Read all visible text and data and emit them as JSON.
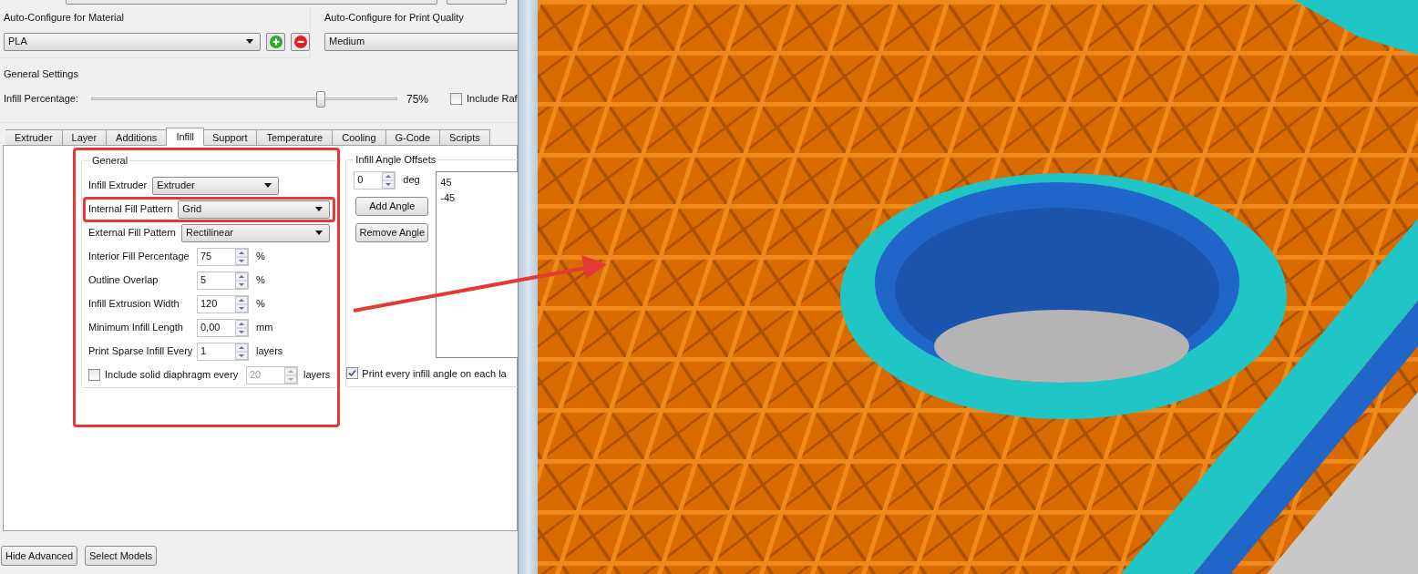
{
  "material": {
    "label": "Auto-Configure for Material",
    "value": "PLA"
  },
  "quality": {
    "label": "Auto-Configure for Print Quality",
    "value": "Medium"
  },
  "general_settings": {
    "title": "General Settings",
    "infill_label": "Infill Percentage:",
    "level": 0.75,
    "reading": "75%",
    "raft": {
      "label": "Include Raf",
      "checked": false
    }
  },
  "tabs": [
    {
      "label": "Extruder",
      "selected": false
    },
    {
      "label": "Layer",
      "selected": false
    },
    {
      "label": "Additions",
      "selected": false
    },
    {
      "label": "Infill",
      "selected": true
    },
    {
      "label": "Support",
      "selected": false
    },
    {
      "label": "Temperature",
      "selected": false
    },
    {
      "label": "Cooling",
      "selected": false
    },
    {
      "label": "G-Code",
      "selected": false
    },
    {
      "label": "Scripts",
      "selected": false
    }
  ],
  "general": {
    "title": "General",
    "annotated": true,
    "fields": [
      {
        "kind": "dropdown",
        "label": "Infill Extruder",
        "value": "Extruder",
        "annotated": false
      },
      {
        "kind": "dropdown",
        "label": "Internal Fill Pattern",
        "value": "Grid",
        "annotated": true
      },
      {
        "kind": "dropdown",
        "label": "External Fill Pattern",
        "value": "Rectilinear",
        "annotated": false
      },
      {
        "kind": "spinner",
        "label": "Interior Fill Percentage",
        "value": "75",
        "unit": "%",
        "annotated": false
      },
      {
        "kind": "spinner",
        "label": "Outline Overlap",
        "value": "5",
        "unit": "%",
        "annotated": false
      },
      {
        "kind": "spinner",
        "label": "Infill Extrusion Width",
        "value": "120",
        "unit": "%",
        "annotated": false
      },
      {
        "kind": "spinner",
        "label": "Minimum Infill Length",
        "value": "0,00",
        "unit": "mm",
        "annotated": false
      },
      {
        "kind": "spinner",
        "label": "Print Sparse Infill Every",
        "value": "1",
        "unit": "layers",
        "annotated": false
      },
      {
        "kind": "check_spinner",
        "label": "Include solid diaphragm every",
        "checked": false,
        "value": "20",
        "unit": "layers",
        "annotated": false
      }
    ]
  },
  "angle_offsets": {
    "title": "Infill Angle Offsets",
    "value": "0",
    "unit": "deg",
    "buttons": [
      "Add Angle",
      "Remove Angle"
    ],
    "angles": [
      "45",
      "-45"
    ],
    "every_angle": {
      "label": "Print every infill angle on each la",
      "checked": true
    }
  },
  "footer_buttons": [
    "Hide Advanced",
    "Select Models"
  ]
}
